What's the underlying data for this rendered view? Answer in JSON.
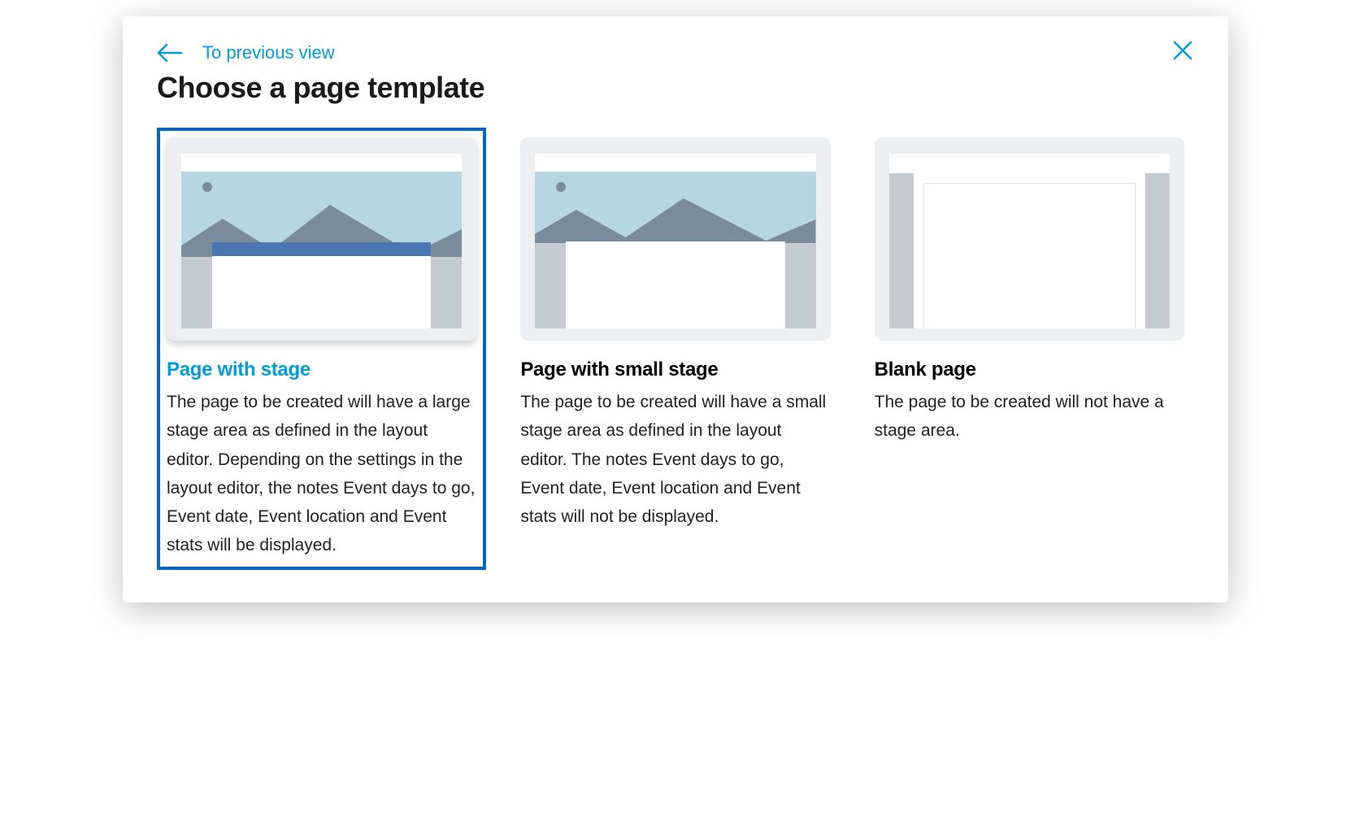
{
  "header": {
    "back_label": "To previous view",
    "title": "Choose a page template"
  },
  "templates": [
    {
      "title": "Page with stage",
      "description": "The page to be created will have a large stage area as defined in the layout editor. Depending on the settings in the layout editor, the notes Event days to go, Event date, Event location and Event stats will be displayed.",
      "selected": true
    },
    {
      "title": "Page with small stage",
      "description": "The page to be created will have a small stage area as defined in the layout editor. The notes Event days to go, Event date, Event location and Event stats will not be displayed.",
      "selected": false
    },
    {
      "title": "Blank page",
      "description": "The page to be created will not have a stage area.",
      "selected": false
    }
  ]
}
